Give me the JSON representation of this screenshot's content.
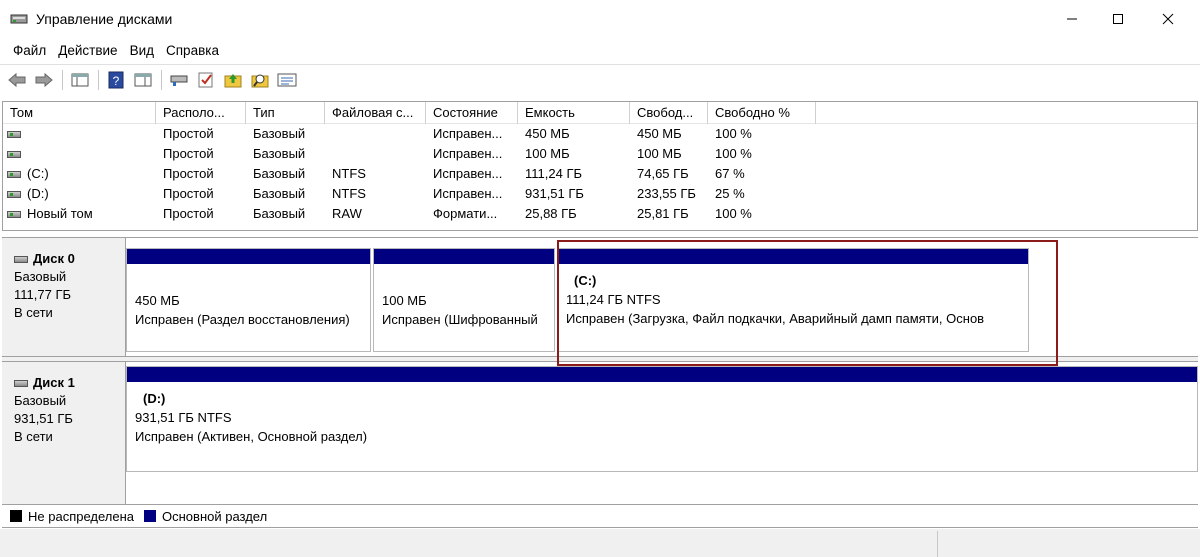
{
  "window": {
    "title": "Управление дисками"
  },
  "menu": [
    "Файл",
    "Действие",
    "Вид",
    "Справка"
  ],
  "toolbar": {
    "icons": [
      "back-arrow-icon",
      "forward-arrow-icon",
      "console-tree-icon",
      "help-icon",
      "show-pane-icon",
      "connect-icon",
      "check-icon",
      "up-folder-icon",
      "search-folder-icon",
      "properties-list-icon"
    ]
  },
  "volume_table": {
    "columns": [
      "Том",
      "Располо...",
      "Тип",
      "Файловая с...",
      "Состояние",
      "Емкость",
      "Свобод...",
      "Свободно %"
    ],
    "rows": [
      [
        "",
        "Простой",
        "Базовый",
        "",
        "Исправен...",
        "450 МБ",
        "450 МБ",
        "100 %"
      ],
      [
        "",
        "Простой",
        "Базовый",
        "",
        "Исправен...",
        "100 МБ",
        "100 МБ",
        "100 %"
      ],
      [
        "(C:)",
        "Простой",
        "Базовый",
        "NTFS",
        "Исправен...",
        "111,24 ГБ",
        "74,65 ГБ",
        "67 %"
      ],
      [
        "(D:)",
        "Простой",
        "Базовый",
        "NTFS",
        "Исправен...",
        "931,51 ГБ",
        "233,55 ГБ",
        "25 %"
      ],
      [
        "Новый том",
        "Простой",
        "Базовый",
        "RAW",
        "Формати...",
        "25,88 ГБ",
        "25,81 ГБ",
        "100 %"
      ]
    ]
  },
  "disks": [
    {
      "name": "Диск 0",
      "type": "Базовый",
      "size": "111,77 ГБ",
      "status": "В сети",
      "partitions": [
        {
          "name": "",
          "size": "450 МБ",
          "status": "Исправен (Раздел восстановления)"
        },
        {
          "name": "",
          "size": "100 МБ",
          "status": "Исправен (Шифрованный"
        },
        {
          "name": "(C:)",
          "size": "111,24 ГБ NTFS",
          "status": "Исправен (Загрузка, Файл подкачки, Аварийный дамп памяти, Основ"
        }
      ]
    },
    {
      "name": "Диск 1",
      "type": "Базовый",
      "size": "931,51 ГБ",
      "status": "В сети",
      "partitions": [
        {
          "name": "(D:)",
          "size": "931,51 ГБ NTFS",
          "status": "Исправен (Активен, Основной раздел)"
        }
      ]
    }
  ],
  "legend": [
    {
      "label": "Не распределена",
      "color": "#000000"
    },
    {
      "label": "Основной раздел",
      "color": "#000080"
    }
  ]
}
